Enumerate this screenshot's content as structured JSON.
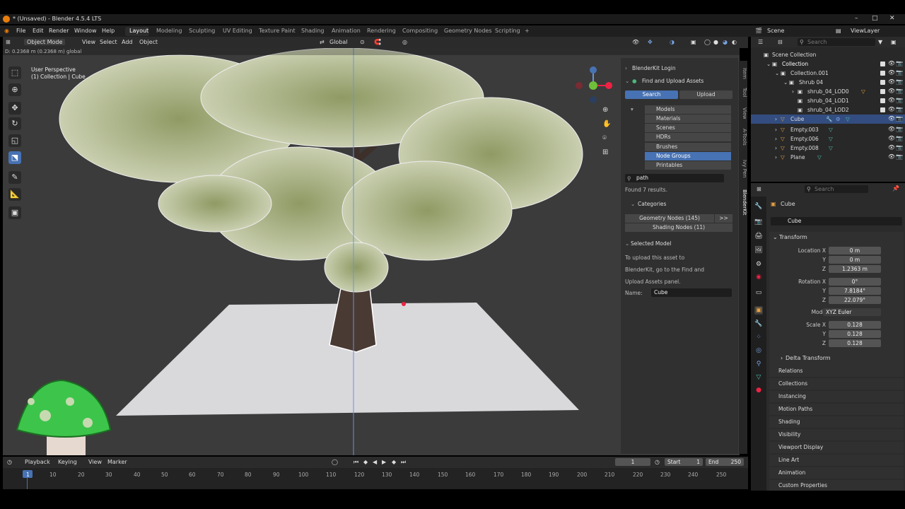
{
  "window": {
    "title": "* (Unsaved) - Blender 4.5.4 LTS"
  },
  "menu": [
    "File",
    "Edit",
    "Render",
    "Window",
    "Help"
  ],
  "workspaces": [
    "Layout",
    "Modeling",
    "Sculpting",
    "UV Editing",
    "Texture Paint",
    "Shading",
    "Animation",
    "Rendering",
    "Compositing",
    "Geometry Nodes",
    "Scripting"
  ],
  "add_workspace": "+",
  "scene": {
    "name": "Scene",
    "view_layer": "ViewLayer"
  },
  "viewport": {
    "mode": "Object Mode",
    "menus": [
      "View",
      "Select",
      "Add",
      "Object"
    ],
    "orientation": "Global",
    "info": "D: 0.2368 m (0.2368 m) global",
    "perspective": "User Perspective",
    "collection_label": "(1) Collection | Cube"
  },
  "blenderkit": {
    "login": "BlenderKit Login",
    "find_upload": "Find and Upload Assets",
    "search_tab": "Search",
    "upload_tab": "Upload",
    "categories": [
      "Models",
      "Materials",
      "Scenes",
      "HDRs",
      "Brushes",
      "Node Groups",
      "Printables"
    ],
    "selected_category": "Node Groups",
    "search_value": "path",
    "results": "Found 7 results.",
    "categories_title": "Categories",
    "category_results": [
      "Geometry Nodes (145)",
      "Shading Nodes (11)"
    ],
    "more": ">>",
    "selected_model_title": "Selected Model",
    "upload_hint": [
      "To upload this asset to",
      "BlenderKit, go to the Find and",
      "Upload Assets panel."
    ],
    "name_label": "Name:",
    "name_value": "Cube"
  },
  "npanel_tabs": [
    "Item",
    "Tool",
    "View",
    "A-Tools",
    "Ivy Pen",
    "BlenderKit"
  ],
  "outliner": {
    "search_placeholder": "Search",
    "rows": [
      {
        "label": "Scene Collection",
        "indent": 0
      },
      {
        "label": "Collection",
        "indent": 1
      },
      {
        "label": "Collection.001",
        "indent": 2
      },
      {
        "label": "Shrub 04",
        "indent": 3
      },
      {
        "label": "shrub_04_LOD0",
        "indent": 4
      },
      {
        "label": "shrub_04_LOD1",
        "indent": 4
      },
      {
        "label": "shrub_04_LOD2",
        "indent": 4
      },
      {
        "label": "Cube",
        "indent": 2
      },
      {
        "label": "Empty.003",
        "indent": 2
      },
      {
        "label": "Empty.006",
        "indent": 2
      },
      {
        "label": "Empty.008",
        "indent": 2
      },
      {
        "label": "Plane",
        "indent": 2
      }
    ],
    "selected": "Cube"
  },
  "properties": {
    "search_placeholder": "Search",
    "object_name": "Cube",
    "transform_title": "Transform",
    "location_label": "Location X",
    "location": [
      "0 m",
      "0 m",
      "1.2363 m"
    ],
    "rotation_label": "Rotation X",
    "rotation": [
      "0°",
      "7.8184°",
      "22.079°"
    ],
    "mode_label": "Mode",
    "mode_value": "XYZ Euler",
    "scale_label": "Scale X",
    "scale": [
      "0.128",
      "0.128",
      "0.128"
    ],
    "axis_y": "Y",
    "axis_z": "Z",
    "delta": "Delta Transform",
    "sections": [
      "Relations",
      "Collections",
      "Instancing",
      "Motion Paths",
      "Shading",
      "Visibility",
      "Viewport Display",
      "Line Art",
      "Animation",
      "Custom Properties"
    ]
  },
  "timeline": {
    "menus": [
      "Playback",
      "Keying",
      "View",
      "Marker"
    ],
    "current_frame": "1",
    "start_label": "Start",
    "start": "1",
    "end_label": "End",
    "end": "250",
    "ticks": [
      "1",
      "10",
      "20",
      "30",
      "40",
      "50",
      "60",
      "70",
      "80",
      "90",
      "100",
      "110",
      "120",
      "130",
      "140",
      "150",
      "160",
      "170",
      "180",
      "190",
      "200",
      "210",
      "220",
      "230",
      "240",
      "250"
    ]
  },
  "colors": {
    "accent": "#4772b3",
    "blender_orange": "#e87d0d",
    "plane": "#d9d9dc"
  }
}
